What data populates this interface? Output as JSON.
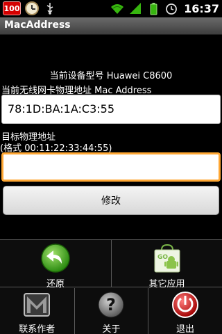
{
  "statusbar": {
    "battery_level": "100",
    "time": "16:37",
    "icons": [
      "battery-icon",
      "clock-icon",
      "usb-icon",
      "wifi-icon",
      "signal-icon",
      "battery-status-icon",
      "alarm-icon"
    ]
  },
  "app": {
    "title": "MacAddress"
  },
  "main": {
    "device_model": "当前设备型号 Huawei C8600",
    "current_mac_label": "当前无线网卡物理地址 Mac Address",
    "current_mac_value": "78:1D:BA:1A:C3:55",
    "target_label": "目标物理地址",
    "format_hint": "(格式 00:11:22:33:44:55)",
    "target_value": "",
    "target_placeholder": "",
    "modify_button": "修改"
  },
  "menu": {
    "items": [
      {
        "label": "还原",
        "icon": "restore-icon"
      },
      {
        "label": "其它应用",
        "icon": "market-icon"
      },
      {
        "label": "联系作者",
        "icon": "mail-icon"
      },
      {
        "label": "关于",
        "icon": "help-icon"
      },
      {
        "label": "退出",
        "icon": "exit-icon"
      }
    ]
  },
  "colors": {
    "accent_focus": "#ffa733",
    "restore_green": "#3ea318",
    "exit_red": "#d40000",
    "title_bar": "#555555"
  }
}
